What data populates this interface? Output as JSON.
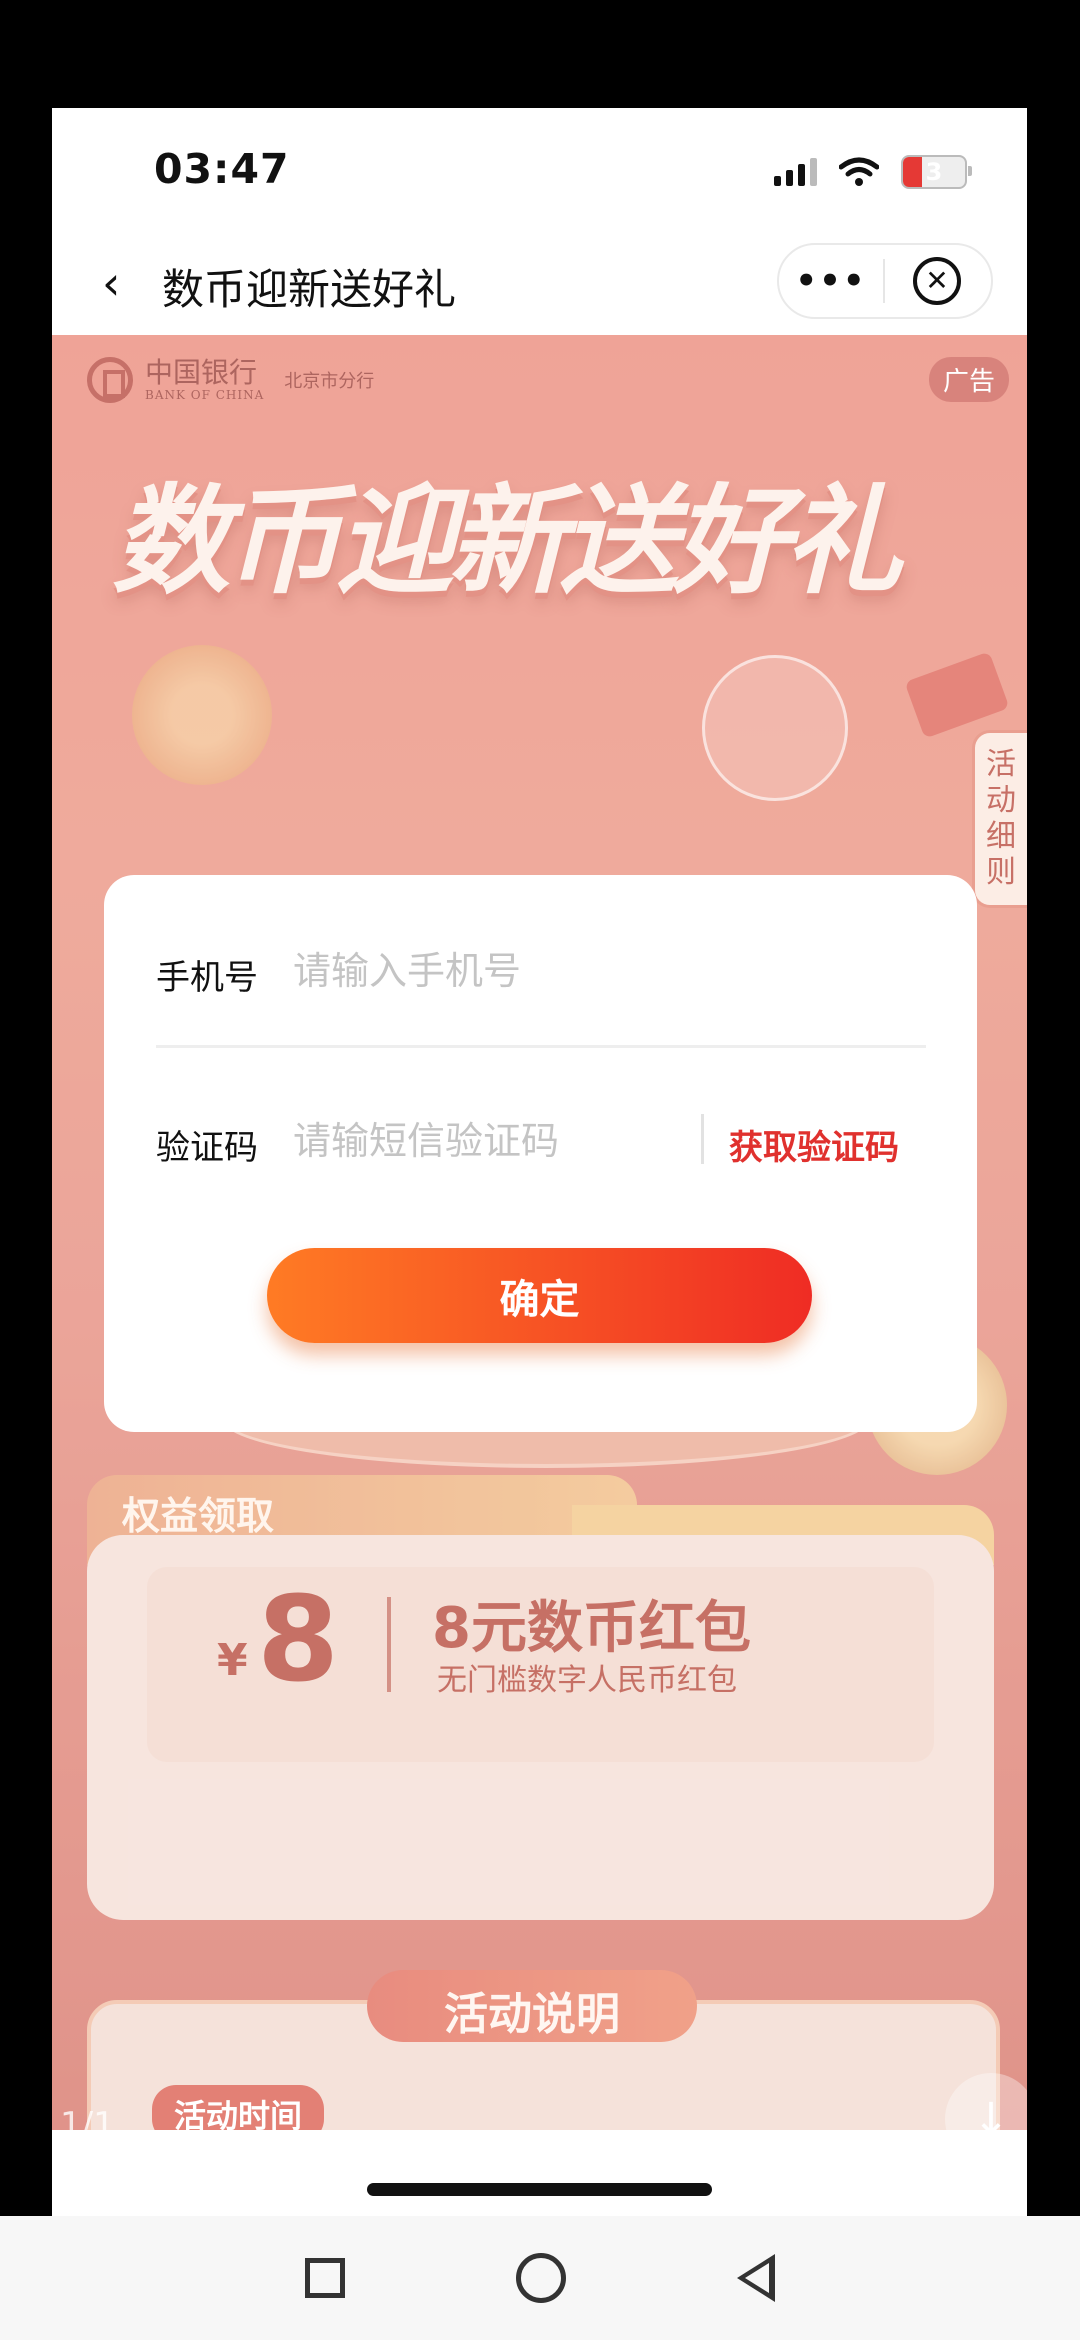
{
  "status": {
    "time": "03:47",
    "battery": "3"
  },
  "nav": {
    "back_icon": "chevron-left-icon",
    "title": "数币迎新送好礼",
    "more_label": "•••",
    "close_label": "✕"
  },
  "banner": {
    "bank_name": "中国银行",
    "bank_name_en": "BANK OF CHINA",
    "branch": "北京市分行",
    "ad_badge": "广告",
    "title": "数币迎新送好礼",
    "side_tag": "活动细则"
  },
  "benefit": {
    "section_label": "权益领取",
    "currency": "¥",
    "amount": "8",
    "coupon_title": "8元数币红包",
    "coupon_sub": "无门槛数字人民币红包"
  },
  "description": {
    "title": "活动说明",
    "time_chip": "活动时间"
  },
  "pager": "1/1",
  "modal": {
    "phone_label": "手机号",
    "phone_placeholder": "请输入手机号",
    "code_label": "验证码",
    "code_placeholder": "请输短信验证码",
    "get_code": "获取验证码",
    "confirm": "确定"
  },
  "colors": {
    "accent": "#e0312e",
    "button_start": "#ff7b24",
    "button_end": "#ef2c24"
  }
}
